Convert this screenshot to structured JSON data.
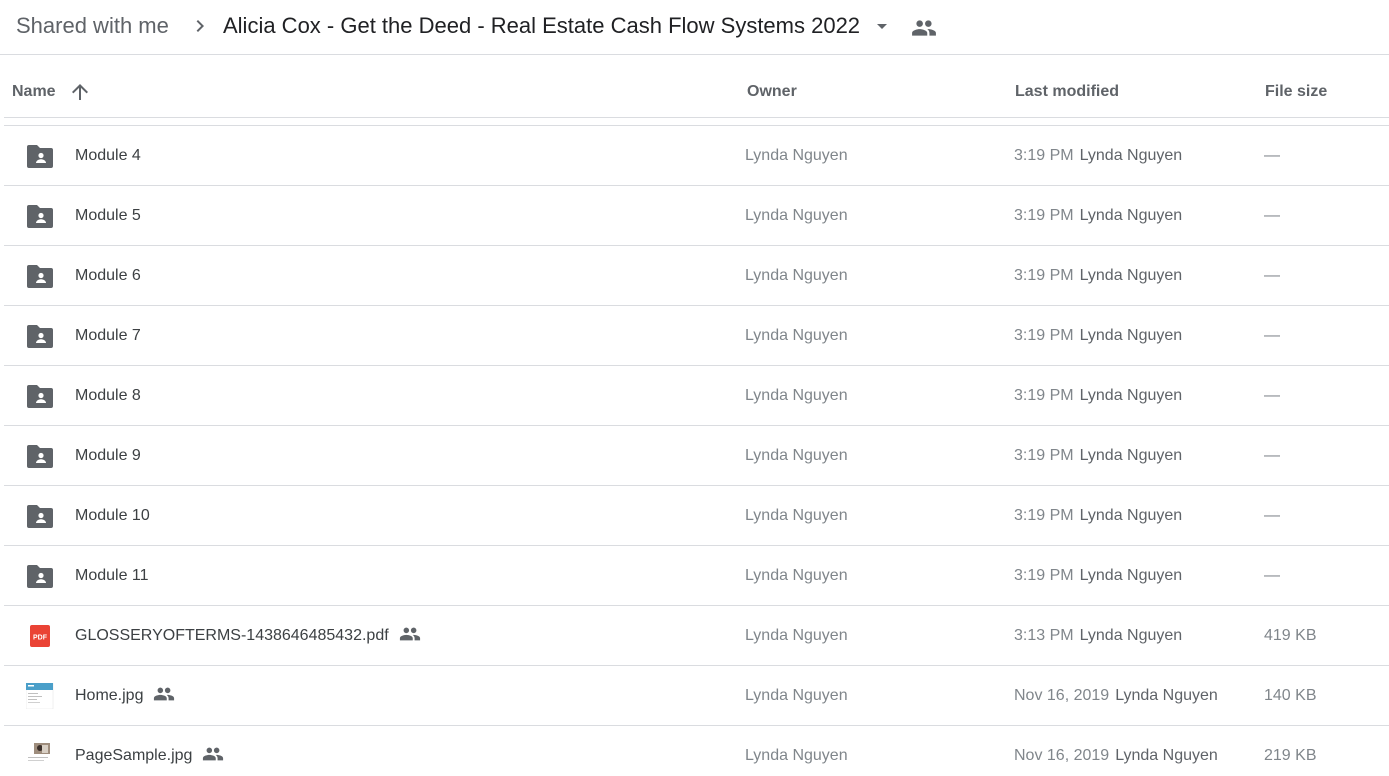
{
  "breadcrumb": {
    "root": "Shared with me",
    "current": "Alicia Cox - Get the Deed - Real Estate Cash Flow Systems 2022"
  },
  "icons": {
    "separator": "chevron-right-icon",
    "dropdown": "arrow-drop-down-icon",
    "shared": "people-icon",
    "sort": "arrow-upward-icon",
    "folder": "shared-folder-icon",
    "pdf": "pdf-icon",
    "image": "image-thumbnail-icon"
  },
  "columns": {
    "name": "Name",
    "owner": "Owner",
    "last_modified": "Last modified",
    "file_size": "File size"
  },
  "rows": [
    {
      "name": "Module 4",
      "type": "folder",
      "shared": false,
      "owner": "Lynda Nguyen",
      "modified": "3:19 PM",
      "modified_by": "Lynda Nguyen",
      "size": "—"
    },
    {
      "name": "Module 5",
      "type": "folder",
      "shared": false,
      "owner": "Lynda Nguyen",
      "modified": "3:19 PM",
      "modified_by": "Lynda Nguyen",
      "size": "—"
    },
    {
      "name": "Module 6",
      "type": "folder",
      "shared": false,
      "owner": "Lynda Nguyen",
      "modified": "3:19 PM",
      "modified_by": "Lynda Nguyen",
      "size": "—"
    },
    {
      "name": "Module 7",
      "type": "folder",
      "shared": false,
      "owner": "Lynda Nguyen",
      "modified": "3:19 PM",
      "modified_by": "Lynda Nguyen",
      "size": "—"
    },
    {
      "name": "Module 8",
      "type": "folder",
      "shared": false,
      "owner": "Lynda Nguyen",
      "modified": "3:19 PM",
      "modified_by": "Lynda Nguyen",
      "size": "—"
    },
    {
      "name": "Module 9",
      "type": "folder",
      "shared": false,
      "owner": "Lynda Nguyen",
      "modified": "3:19 PM",
      "modified_by": "Lynda Nguyen",
      "size": "—"
    },
    {
      "name": "Module 10",
      "type": "folder",
      "shared": false,
      "owner": "Lynda Nguyen",
      "modified": "3:19 PM",
      "modified_by": "Lynda Nguyen",
      "size": "—"
    },
    {
      "name": "Module 11",
      "type": "folder",
      "shared": false,
      "owner": "Lynda Nguyen",
      "modified": "3:19 PM",
      "modified_by": "Lynda Nguyen",
      "size": "—"
    },
    {
      "name": "GLOSSERYOFTERMS-1438646485432.pdf",
      "type": "pdf",
      "shared": true,
      "owner": "Lynda Nguyen",
      "modified": "3:13 PM",
      "modified_by": "Lynda Nguyen",
      "size": "419 KB"
    },
    {
      "name": "Home.jpg",
      "type": "image",
      "shared": true,
      "owner": "Lynda Nguyen",
      "modified": "Nov 16, 2019",
      "modified_by": "Lynda Nguyen",
      "size": "140 KB"
    },
    {
      "name": "PageSample.jpg",
      "type": "image2",
      "shared": true,
      "owner": "Lynda Nguyen",
      "modified": "Nov 16, 2019",
      "modified_by": "Lynda Nguyen",
      "size": "219 KB"
    }
  ],
  "colors": {
    "icon_gray": "#5f6368",
    "pdf_red": "#ea4335",
    "divider": "#dadce0"
  }
}
